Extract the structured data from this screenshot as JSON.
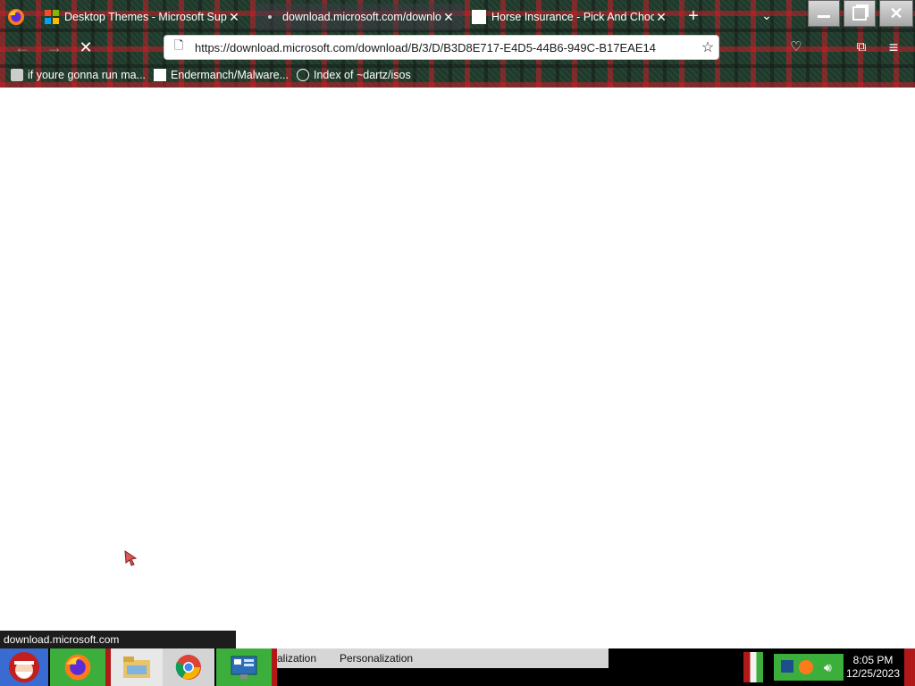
{
  "tabs": [
    {
      "title": "Desktop Themes - Microsoft Supp",
      "favicon": "microsoft-logo-icon",
      "active": false
    },
    {
      "title": "download.microsoft.com/downlo",
      "favicon": "loading-dot-icon",
      "active": true
    },
    {
      "title": "Horse Insurance - Pick And Choos",
      "favicon": "page-icon",
      "active": false
    }
  ],
  "navbar": {
    "url": "https://download.microsoft.com/download/B/3/D/B3D8E717-E4D5-44B6-949C-B17EAE14"
  },
  "bookmarks": [
    {
      "label": "if youre gonna run ma...",
      "icon": "puzzle-icon"
    },
    {
      "label": "Endermanch/Malware...",
      "icon": "page-icon"
    },
    {
      "label": "Index of ~dartz/isos",
      "icon": "globe-icon"
    }
  ],
  "status": {
    "text": "download.microsoft.com"
  },
  "taskbar": {
    "strip_items": [
      "alization",
      "Personalization"
    ],
    "clock_time": "8:05 PM",
    "clock_date": "12/25/2023"
  },
  "colors": {
    "tab_active": "#3c3c46",
    "taskbar_green": "#3cae3c",
    "taskbar_red": "#b11919",
    "urlbar": "#ffffff"
  }
}
